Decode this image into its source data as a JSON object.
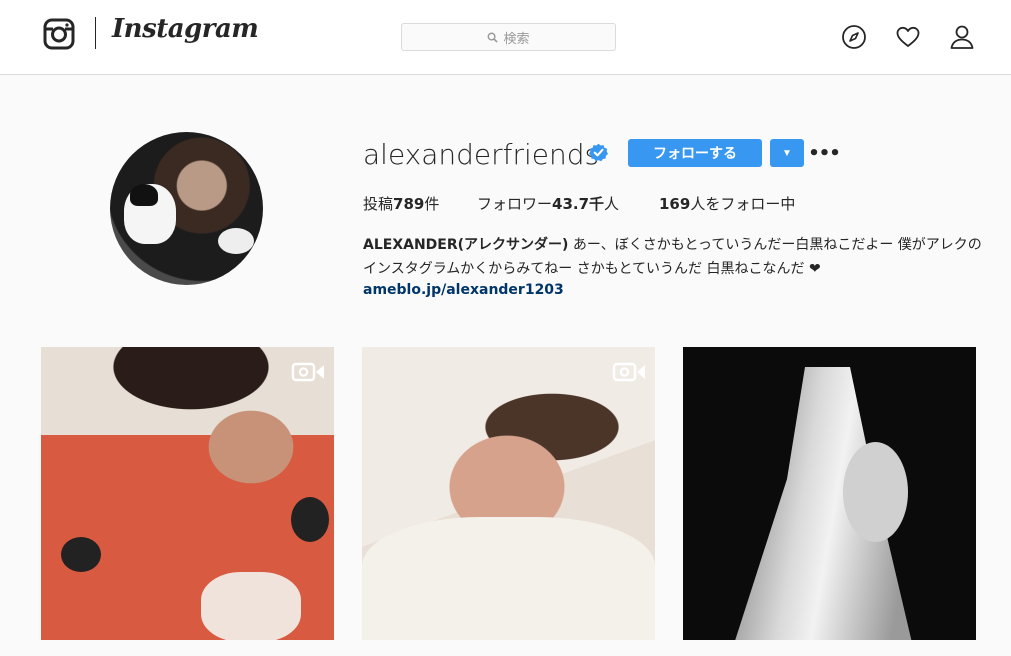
{
  "header": {
    "wordmark": "Instagram",
    "search_placeholder": "検索",
    "icons": [
      "instagram-logo-icon",
      "search-icon",
      "compass-icon",
      "heart-icon",
      "user-icon"
    ]
  },
  "profile": {
    "username": "alexanderfriends",
    "follow_label": "フォローする",
    "stats": {
      "posts_label": "投稿",
      "posts_value": "789",
      "posts_unit": "件",
      "followers_label": "フォロワー",
      "followers_value": "43.7千",
      "followers_unit": "人",
      "following_value": "169",
      "following_label": "人をフォロー中"
    },
    "bio_name": "ALEXANDER(アレクサンダー)",
    "bio_text": " あー、ぼくさかもとっていうんだー白黒ねこだよー 僕がアレクのインスタグラムかくからみてねー さかもとていうんだ 白黒ねこなんだ ❤",
    "bio_link": "ameblo.jp/alexander1203"
  },
  "colors": {
    "accent": "#3897f0",
    "link": "#003569",
    "text": "#262626",
    "border": "#dbdbdb",
    "background": "#fafafa"
  }
}
